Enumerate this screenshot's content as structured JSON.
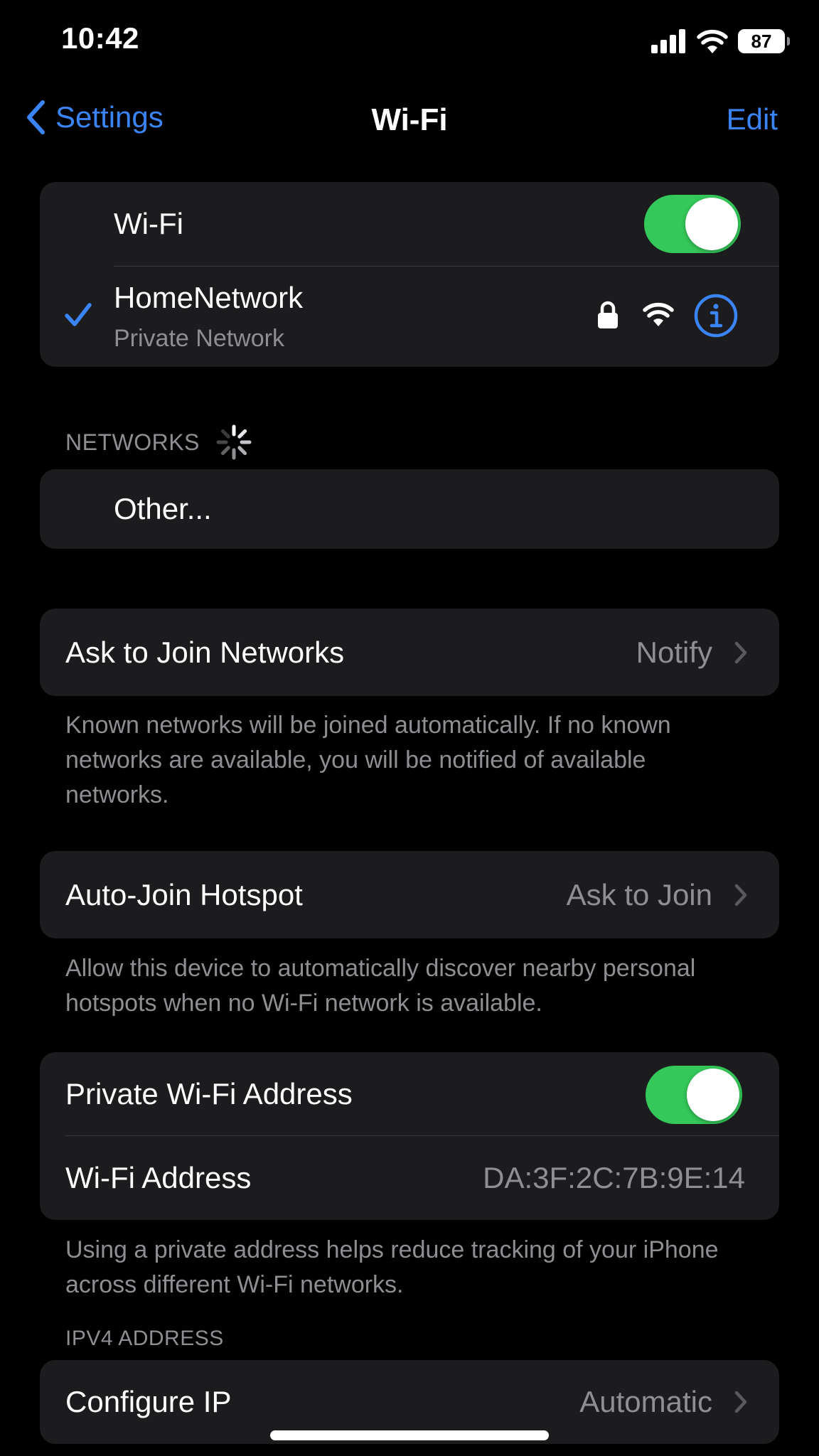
{
  "status_bar": {
    "time": "10:42",
    "battery": "87"
  },
  "nav": {
    "back_label": "Settings",
    "title": "Wi-Fi",
    "edit_label": "Edit"
  },
  "wifi_group": {
    "wifi_label": "Wi-Fi",
    "wifi_on": true,
    "network_name": "HomeNetwork",
    "network_subtitle": "Private Network"
  },
  "networks": {
    "header": "NETWORKS",
    "other_label": "Other..."
  },
  "ask_to_join": {
    "label": "Ask to Join Networks",
    "value": "Notify",
    "footer": "Known networks will be joined automatically. If no known networks are available, you will be notified of available networks."
  },
  "auto_join_hotspot": {
    "label": "Auto-Join Hotspot",
    "value": "Ask to Join",
    "footer": "Allow this device to automatically discover nearby personal hotspots when no Wi-Fi network is available."
  },
  "private_address": {
    "label": "Private Wi-Fi Address",
    "enabled": true,
    "address_label": "Wi-Fi Address",
    "address_value": "DA:3F:2C:7B:9E:14",
    "footer": "Using a private address helps reduce tracking of your iPhone across different Wi-Fi networks."
  },
  "ipv4": {
    "header": "IPV4 ADDRESS",
    "configure_label": "Configure IP",
    "configure_value": "Automatic"
  },
  "colors": {
    "accent": "#3a84f5",
    "toggle_on": "#34c759",
    "cell_bg": "#1c1c1e",
    "secondary_text": "#8e8e93"
  }
}
